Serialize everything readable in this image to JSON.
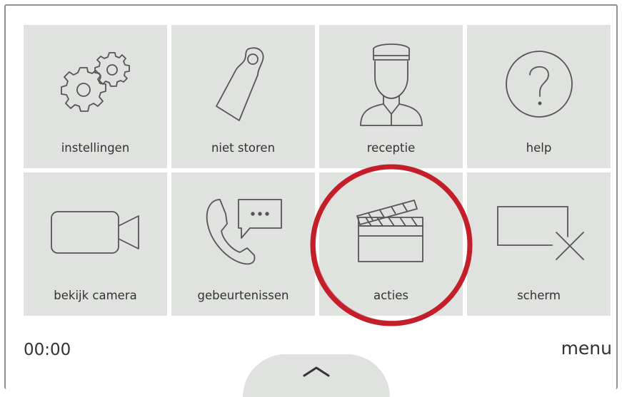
{
  "tiles": [
    {
      "label": "instellingen",
      "icon": "gears-icon"
    },
    {
      "label": "niet storen",
      "icon": "door-hanger-icon"
    },
    {
      "label": "receptie",
      "icon": "receptionist-icon"
    },
    {
      "label": "help",
      "icon": "help-icon"
    },
    {
      "label": "bekijk camera",
      "icon": "camera-icon"
    },
    {
      "label": "gebeurtenissen",
      "icon": "phone-message-icon"
    },
    {
      "label": "acties",
      "icon": "clapperboard-icon"
    },
    {
      "label": "scherm",
      "icon": "screen-off-icon"
    }
  ],
  "status": {
    "time": "00:00"
  },
  "menu_label": "menu",
  "colors": {
    "tile_bg": "#dfe2de",
    "icon_stroke": "#555555",
    "highlight_ring": "#c41e2a"
  }
}
